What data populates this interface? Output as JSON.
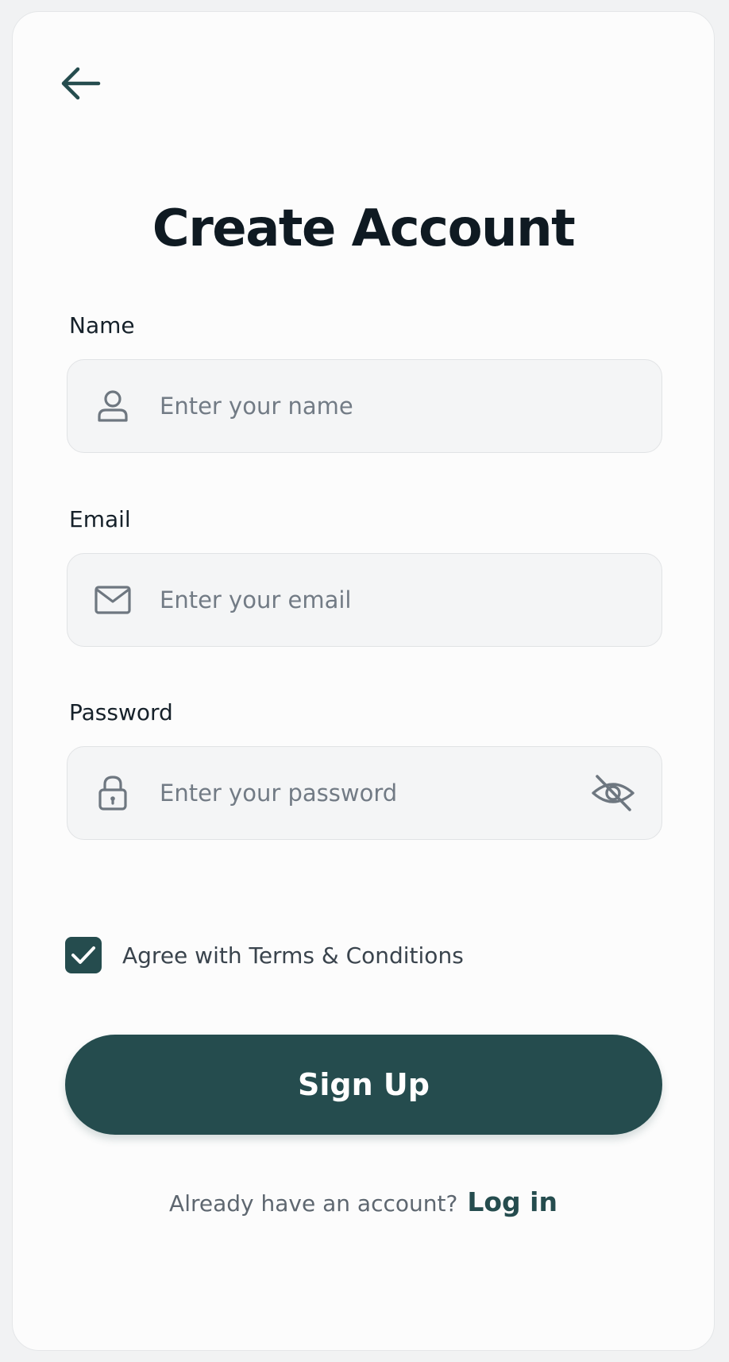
{
  "page": {
    "title": "Create Account"
  },
  "form": {
    "name": {
      "label": "Name",
      "placeholder": "Enter your name",
      "value": "",
      "icon": "user-icon"
    },
    "email": {
      "label": "Email",
      "placeholder": "Enter your email",
      "value": "",
      "icon": "mail-icon"
    },
    "password": {
      "label": "Password",
      "placeholder": "Enter your password",
      "value": "",
      "icon": "lock-icon",
      "toggle_icon": "eye-off-icon"
    },
    "terms": {
      "checked": true,
      "label": "Agree with Terms & Conditions"
    },
    "submit_label": "Sign Up"
  },
  "footer": {
    "prompt": "Already have an account?",
    "link_label": "Log in"
  },
  "colors": {
    "accent": "#254c4e",
    "text_primary": "#0f1a22",
    "placeholder": "#727b85"
  },
  "icons": {
    "back": "arrow-left-icon",
    "check": "check-icon"
  }
}
